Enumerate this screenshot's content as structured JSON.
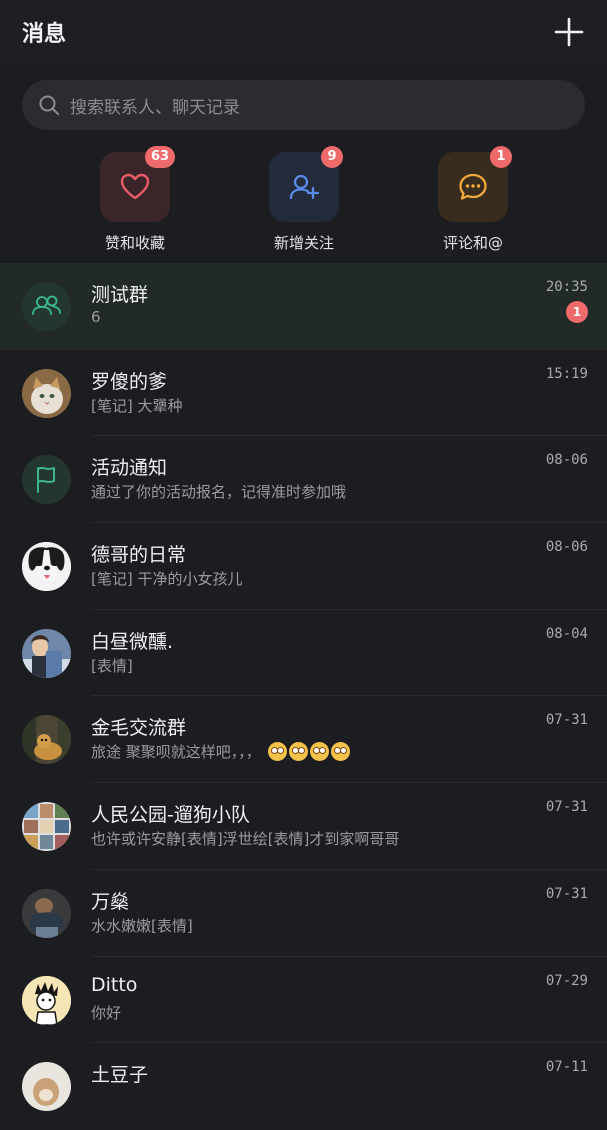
{
  "header": {
    "title": "消息"
  },
  "search": {
    "placeholder": "搜索联系人、聊天记录"
  },
  "quick_actions": [
    {
      "label": "赞和收藏",
      "badge": "63",
      "color": "#e95c67",
      "tile_bg": "#3a2628"
    },
    {
      "label": "新增关注",
      "badge": "9",
      "color": "#5a8be8",
      "tile_bg": "#232a3a"
    },
    {
      "label": "评论和@",
      "badge": "1",
      "color": "#f3a93c",
      "tile_bg": "#372c1d"
    }
  ],
  "conversations": [
    {
      "name": "测试群",
      "preview": "6",
      "time": "20:35",
      "unread": "1",
      "avatar": "group-icon",
      "pinned": true
    },
    {
      "name": "罗傻的爹",
      "preview": "[笔记] 大犟种",
      "time": "15:19",
      "avatar": "cat-photo"
    },
    {
      "name": "活动通知",
      "preview": "通过了你的活动报名，记得准时参加哦",
      "time": "08-06",
      "avatar": "flag-icon"
    },
    {
      "name": "德哥的日常",
      "preview": "[笔记] 干净的小女孩儿",
      "time": "08-06",
      "avatar": "dog-photo"
    },
    {
      "name": "白昼微醺.",
      "preview": "[表情]",
      "time": "08-04",
      "avatar": "person-photo"
    },
    {
      "name": "金毛交流群",
      "preview": "旅途  聚聚呗就这样吧，，，",
      "emojis": 4,
      "time": "07-31",
      "avatar": "golden-retriever-photo"
    },
    {
      "name": "人民公园-遛狗小队",
      "preview": "也许或许安静[表情]浮世绘[表情]才到家啊哥哥",
      "time": "07-31",
      "avatar": "collage-photo"
    },
    {
      "name": "万燊",
      "preview": "水水嫩嫩[表情]",
      "time": "07-31",
      "avatar": "person-photo-2"
    },
    {
      "name": "Ditto",
      "preview": "你好",
      "time": "07-29",
      "avatar": "cartoon-avatar"
    },
    {
      "name": "土豆子",
      "preview": "",
      "time": "07-11",
      "avatar": "dog-photo-2"
    }
  ],
  "colors": {
    "accent_green": "#3dbb8f",
    "badge_red": "#ef6b6b",
    "background": "#1c1d21"
  }
}
